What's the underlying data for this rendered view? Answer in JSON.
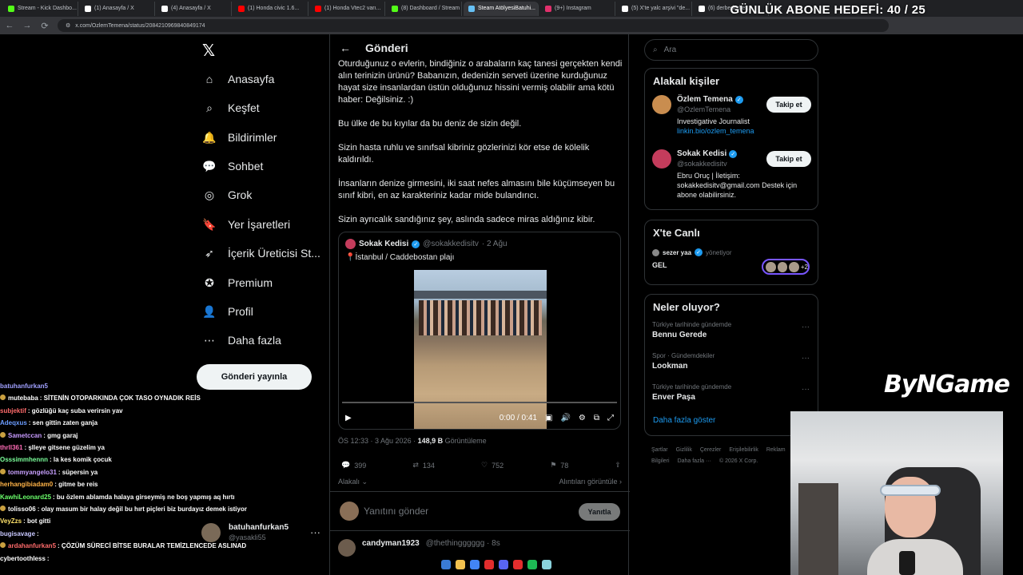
{
  "browser": {
    "tabs": [
      {
        "label": "Stream - Kick Dashbo...",
        "color": "#53fc18"
      },
      {
        "label": "(1) Anasayfa / X",
        "color": "#ffffff"
      },
      {
        "label": "(4) Anasayfa / X",
        "color": "#ffffff"
      },
      {
        "label": "(1) Honda civic 1.6...",
        "color": "#ff0000"
      },
      {
        "label": "(1) Honda Vtec2 varı...",
        "color": "#ff0000"
      },
      {
        "label": "(8) Dashboard / Stream",
        "color": "#53fc18"
      },
      {
        "label": "Steam AtölyesiBatuhi...",
        "color": "#66c0f4"
      },
      {
        "label": "(9+) Instagram",
        "color": "#e1306c"
      },
      {
        "label": "(5) X'te yalc arşivi \"de...",
        "color": "#ffffff"
      },
      {
        "label": "(6) derbederbet...",
        "color": "#ffffff"
      }
    ],
    "url": "x.com/OzlemTemena/status/2084210969840849174"
  },
  "overlay": {
    "goal": "GÜNLÜK ABONE HEDEFİ: 40 / 25",
    "logo": "ByNGame"
  },
  "nav": {
    "items": [
      {
        "label": "Anasayfa",
        "icon": "home-icon"
      },
      {
        "label": "Keşfet",
        "icon": "search-icon"
      },
      {
        "label": "Bildirimler",
        "icon": "bell-icon"
      },
      {
        "label": "Sohbet",
        "icon": "chat-icon"
      },
      {
        "label": "Grok",
        "icon": "grok-icon"
      },
      {
        "label": "Yer İşaretleri",
        "icon": "bookmark-icon"
      },
      {
        "label": "İçerik Üreticisi St...",
        "icon": "rocket-icon"
      },
      {
        "label": "Premium",
        "icon": "premium-icon"
      },
      {
        "label": "Profil",
        "icon": "person-icon"
      },
      {
        "label": "Daha fazla",
        "icon": "more-icon"
      }
    ],
    "post_button": "Gönderi yayınla",
    "account": {
      "name": "batuhanfurkan5",
      "handle": "@yasakli55"
    }
  },
  "post": {
    "header": "Gönderi",
    "paragraphs": [
      "Oturduğunuz o evlerin, bindiğiniz o arabaların kaç tanesi gerçekten kendi alın terinizin ürünü? Babanızın, dedenizin serveti üzerine kurduğunuz hayat size insanlardan üstün olduğunuz hissini vermiş olabilir ama kötü haber: Değilsiniz. :)",
      "Bu ülke de bu kıyılar da bu deniz de sizin değil.",
      "Sizin hasta ruhlu ve sınıfsal kibriniz gözlerinizi kör etse de kölelik kaldırıldı.",
      "İnsanların denize girmesini, iki saat nefes almasını bile küçümseyen bu sınıf kibri, en az karakteriniz kadar mide bulandırıcı.",
      "Sizin ayrıcalık sandığınız şey, aslında sadece miras aldığınız kibir."
    ],
    "quote": {
      "name": "Sokak Kedisi",
      "handle": "@sokakkedisitv",
      "time": "· 2 Ağu",
      "location": "📍İstanbul / Caddebostan plajı",
      "video_time": "0:00 / 0:41"
    },
    "meta": {
      "time": "ÖS 12:33 · 3 Ağu 2026 · ",
      "views": "148,9 B",
      "views_label": " Görüntüleme"
    },
    "stats": {
      "replies": "399",
      "reposts": "134",
      "likes": "752",
      "bookmarks": "78"
    },
    "relevance": "Alakalı",
    "quotes_link": "Alıntıları görüntüle",
    "reply_placeholder": "Yanıtını gönder",
    "reply_button": "Yanıtla",
    "next_reply": {
      "name": "candyman1923",
      "handle": "@thethingggggg · 8s"
    }
  },
  "right": {
    "search_placeholder": "Ara",
    "related_title": "Alakalı kişiler",
    "people": [
      {
        "name": "Özlem Temena",
        "handle": "@OzlemTemena",
        "bio": "Investigative Journalist",
        "link": "linkin.bio/ozlem_temena",
        "follow": "Takip et",
        "color": "#c98d4f"
      },
      {
        "name": "Sokak Kedisi",
        "handle": "@sokakkedisitv",
        "bio": "Ebru Oruç | İletişim: sokakkedisitv@gmail.com Destek için abone olabilirsiniz.",
        "link": "",
        "follow": "Takip et",
        "color": "#c43c5c"
      }
    ],
    "live_title": "X'te Canlı",
    "live": {
      "host": "sezer yaa",
      "status": "yönetiyor",
      "title": "GEL",
      "extra": "+2"
    },
    "trends_title": "Neler oluyor?",
    "trends": [
      {
        "context": "Türkiye tarihinde gündemde",
        "topic": "Bennu Gerede"
      },
      {
        "context": "Spor · Gündemdekiler",
        "topic": "Lookman"
      },
      {
        "context": "Türkiye tarihinde gündemde",
        "topic": "Enver Paşa"
      }
    ],
    "show_more": "Daha fazla göster",
    "footer": [
      "Şartlar",
      "Gizlilik",
      "Çerezler",
      "Erişilebilirlik",
      "Reklam Bilgileri",
      "Daha fazla ···",
      "© 2026 X Corp."
    ]
  },
  "chat": [
    {
      "user": "batuhanfurkan5",
      "msg": "",
      "color": "#a0a0ff"
    },
    {
      "user": "mutebaba",
      "msg": ": SİTENİN OTOPARKINDA ÇOK TASO OYNADIK REİS",
      "color": "#ffffff"
    },
    {
      "user": "subjektif",
      "msg": ": gözlüğü kaç suba verirsin yav",
      "color": "#ff6b6b"
    },
    {
      "user": "Adeqxus",
      "msg": ": sen gittin zaten ganja",
      "color": "#6b9cff"
    },
    {
      "user": "Sametccan",
      "msg": ": gmg garaj",
      "color": "#c89bff"
    },
    {
      "user": "thrll361",
      "msg": ": şlleye gitsene güzelim ya",
      "color": "#ff6bb5"
    },
    {
      "user": "Osssimmhennn",
      "msg": ": la kes komik çocuk",
      "color": "#7bff9b"
    },
    {
      "user": "tommyangelo31",
      "msg": ": süpersin ya",
      "color": "#c8a0ff"
    },
    {
      "user": "herhangibiadam0",
      "msg": ": gitme be reis",
      "color": "#ffb347"
    },
    {
      "user": "KawhiLeonard25",
      "msg": ": bu özlem ablamda halaya girseymiş ne boş yapmış aq hırtı",
      "color": "#6bff6b"
    },
    {
      "user": "tolisso06",
      "msg": ": olay masum bir halay değil bu hırt piçleri biz burdayız demek istiyor",
      "color": "#ffffff"
    },
    {
      "user": "VeyZzs",
      "msg": ": bot gitti",
      "color": "#ffe36b"
    },
    {
      "user": "bugisavage",
      "msg": ":",
      "color": "#c8c8ff"
    },
    {
      "user": "ardahanfurkan5",
      "msg": ": ÇÖZÜM SÜRECİ BİTSE BURALAR TEMİZLENCEDE ASLINAD",
      "color": "#ff6b6b"
    },
    {
      "user": "cybertoothless",
      "msg": ":",
      "color": "#ffffff"
    }
  ],
  "taskbar_icons": [
    "#3a7bd5",
    "#f2c14e",
    "#4285f4",
    "#e22d2d",
    "#5865f2",
    "#e22d2d",
    "#1db954",
    "#8bd3dd"
  ]
}
